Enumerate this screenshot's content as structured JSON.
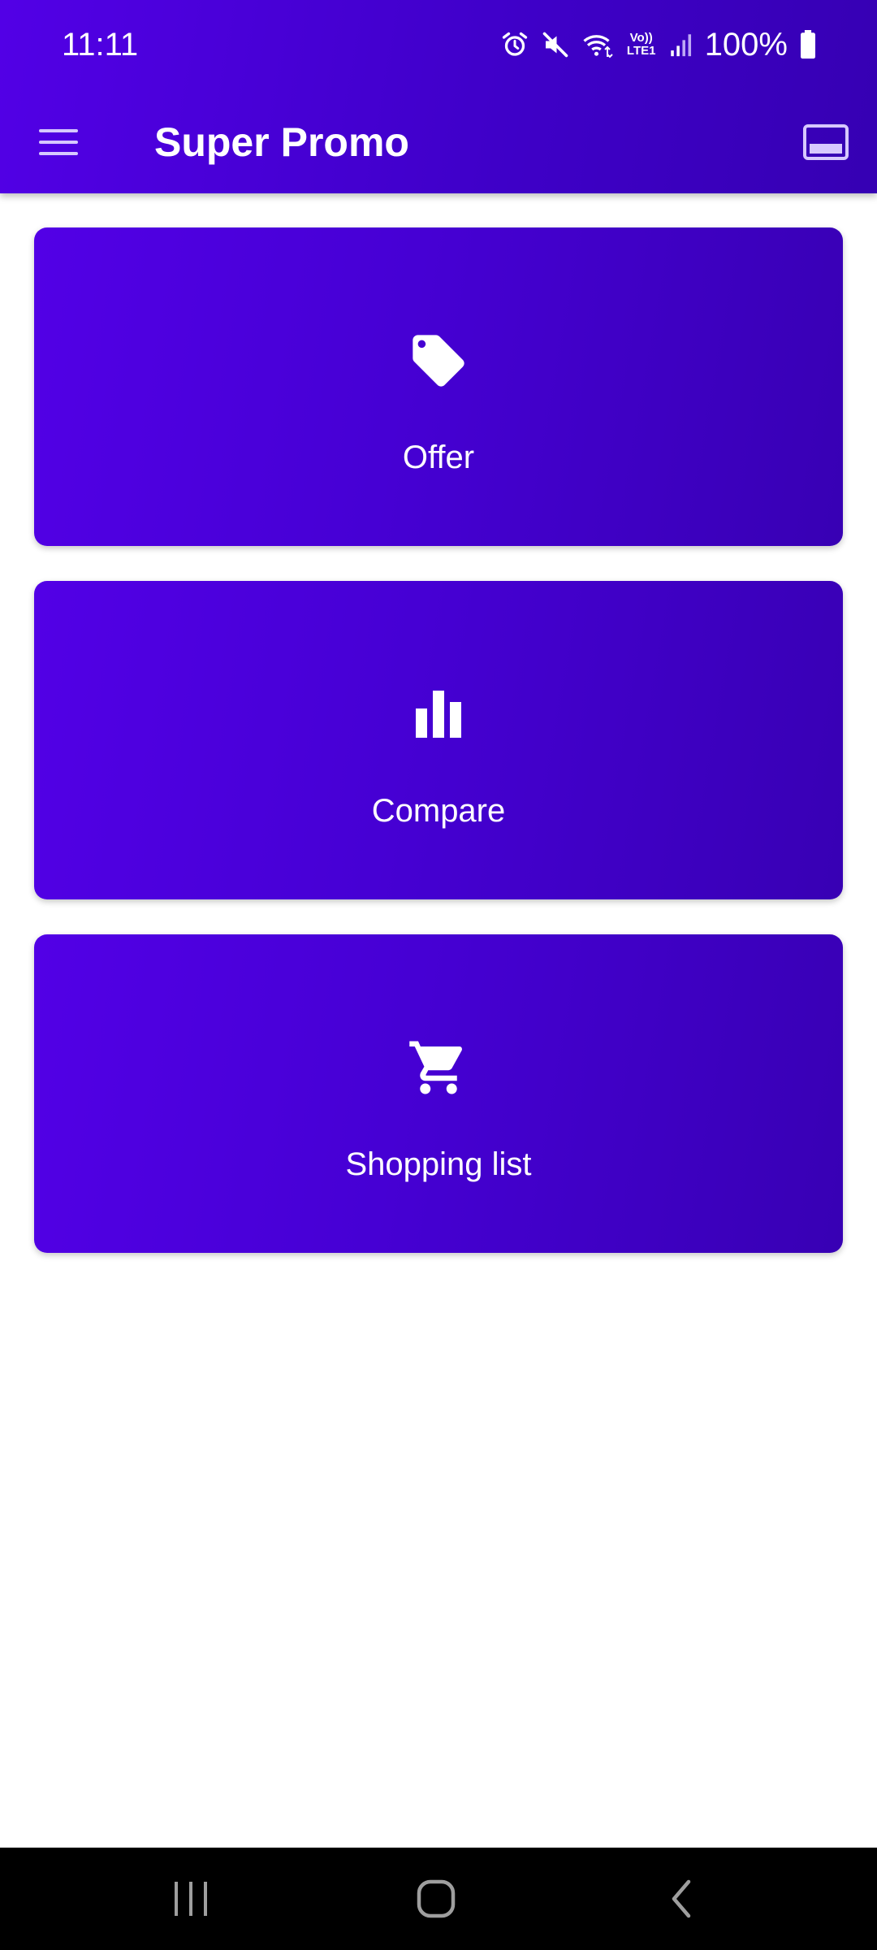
{
  "status_bar": {
    "time": "11:11",
    "network_label": "Vo)) LTE1",
    "battery": "100%",
    "icons": [
      "alarm-icon",
      "mute-icon",
      "wifi-icon",
      "volte-lte-icon",
      "signal-icon",
      "battery-icon"
    ]
  },
  "app_bar": {
    "title": "Super Promo",
    "menu_icon": "hamburger-menu-icon",
    "view_icon": "view-layout-icon"
  },
  "cards": [
    {
      "label": "Offer",
      "icon": "tag-icon"
    },
    {
      "label": "Compare",
      "icon": "bar-chart-icon"
    },
    {
      "label": "Shopping list",
      "icon": "shopping-cart-icon"
    }
  ],
  "nav_bar": {
    "buttons": [
      "recent-apps-icon",
      "home-icon",
      "back-icon"
    ]
  },
  "colors": {
    "primary": "#4a00e0",
    "primary_dark": "#3800b4",
    "text_on_primary": "#ffffff"
  }
}
